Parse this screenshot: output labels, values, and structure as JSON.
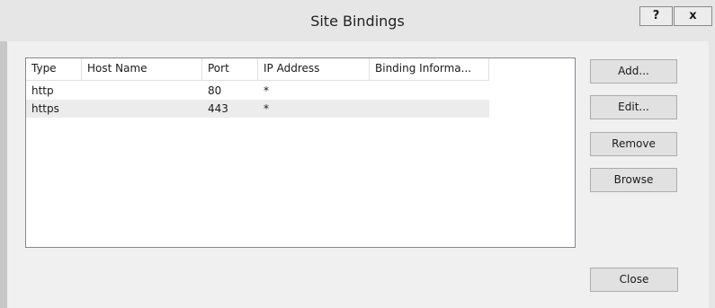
{
  "window": {
    "title": "Site Bindings",
    "help_label": "?",
    "close_label": "x"
  },
  "list": {
    "columns": [
      "Type",
      "Host Name",
      "Port",
      "IP Address",
      "Binding Informa..."
    ],
    "rows": [
      {
        "type": "http",
        "host": "",
        "port": "80",
        "ip": "*",
        "info": ""
      },
      {
        "type": "https",
        "host": "",
        "port": "443",
        "ip": "*",
        "info": ""
      }
    ]
  },
  "buttons": {
    "add": "Add...",
    "edit": "Edit...",
    "remove": "Remove",
    "browse": "Browse",
    "close": "Close"
  }
}
